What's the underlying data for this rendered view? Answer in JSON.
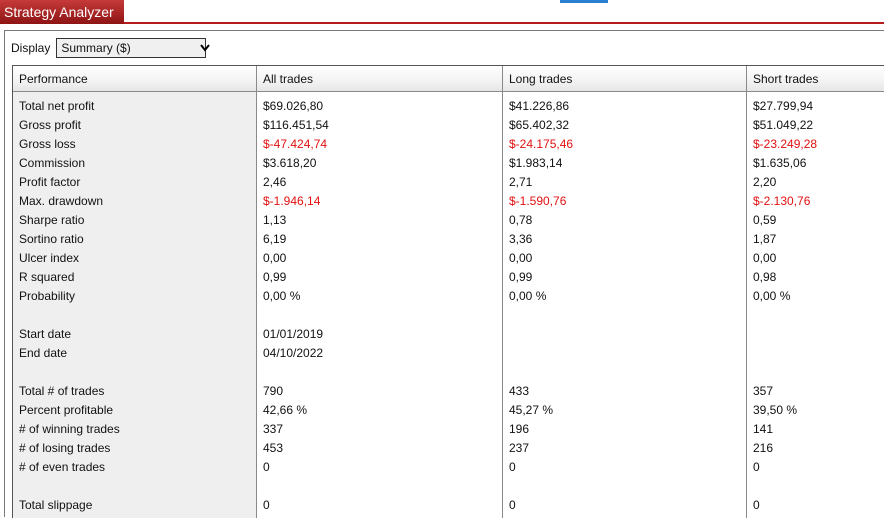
{
  "window": {
    "title": "Strategy Analyzer"
  },
  "display": {
    "label": "Display",
    "selected": "Summary ($)"
  },
  "columns": [
    "Performance",
    "All trades",
    "Long trades",
    "Short trades"
  ],
  "rows": [
    {
      "label": "Total net profit",
      "all": "$69.026,80",
      "long": "$41.226,86",
      "short": "$27.799,94",
      "negative": false
    },
    {
      "label": "Gross profit",
      "all": "$116.451,54",
      "long": "$65.402,32",
      "short": "$51.049,22",
      "negative": false
    },
    {
      "label": "Gross loss",
      "all": "$-47.424,74",
      "long": "$-24.175,46",
      "short": "$-23.249,28",
      "negative": true
    },
    {
      "label": "Commission",
      "all": "$3.618,20",
      "long": "$1.983,14",
      "short": "$1.635,06",
      "negative": false
    },
    {
      "label": "Profit factor",
      "all": "2,46",
      "long": "2,71",
      "short": "2,20",
      "negative": false
    },
    {
      "label": "Max. drawdown",
      "all": "$-1.946,14",
      "long": "$-1.590,76",
      "short": "$-2.130,76",
      "negative": true
    },
    {
      "label": "Sharpe ratio",
      "all": "1,13",
      "long": "0,78",
      "short": "0,59",
      "negative": false
    },
    {
      "label": "Sortino ratio",
      "all": "6,19",
      "long": "3,36",
      "short": "1,87",
      "negative": false
    },
    {
      "label": "Ulcer index",
      "all": "0,00",
      "long": "0,00",
      "short": "0,00",
      "negative": false
    },
    {
      "label": "R squared",
      "all": "0,99",
      "long": "0,99",
      "short": "0,98",
      "negative": false
    },
    {
      "label": "Probability",
      "all": "0,00 %",
      "long": "0,00 %",
      "short": "0,00 %",
      "negative": false
    },
    {
      "label": "",
      "all": "",
      "long": "",
      "short": "",
      "negative": false
    },
    {
      "label": "Start date",
      "all": "01/01/2019",
      "long": "",
      "short": "",
      "negative": false
    },
    {
      "label": "End date",
      "all": "04/10/2022",
      "long": "",
      "short": "",
      "negative": false
    },
    {
      "label": "",
      "all": "",
      "long": "",
      "short": "",
      "negative": false
    },
    {
      "label": "Total # of trades",
      "all": "790",
      "long": "433",
      "short": "357",
      "negative": false
    },
    {
      "label": "Percent profitable",
      "all": "42,66 %",
      "long": "45,27 %",
      "short": "39,50 %",
      "negative": false
    },
    {
      "label": "# of winning trades",
      "all": "337",
      "long": "196",
      "short": "141",
      "negative": false
    },
    {
      "label": "# of losing trades",
      "all": "453",
      "long": "237",
      "short": "216",
      "negative": false
    },
    {
      "label": "# of even trades",
      "all": "0",
      "long": "0",
      "short": "0",
      "negative": false
    },
    {
      "label": "",
      "all": "",
      "long": "",
      "short": "",
      "negative": false
    },
    {
      "label": "Total slippage",
      "all": "0",
      "long": "0",
      "short": "0",
      "negative": false
    }
  ],
  "colors": {
    "negative": "#e01010",
    "title_bar": "#a82020",
    "accent": "#2a7fd0"
  },
  "icons": {
    "dropdown": "chevron-down-icon"
  }
}
